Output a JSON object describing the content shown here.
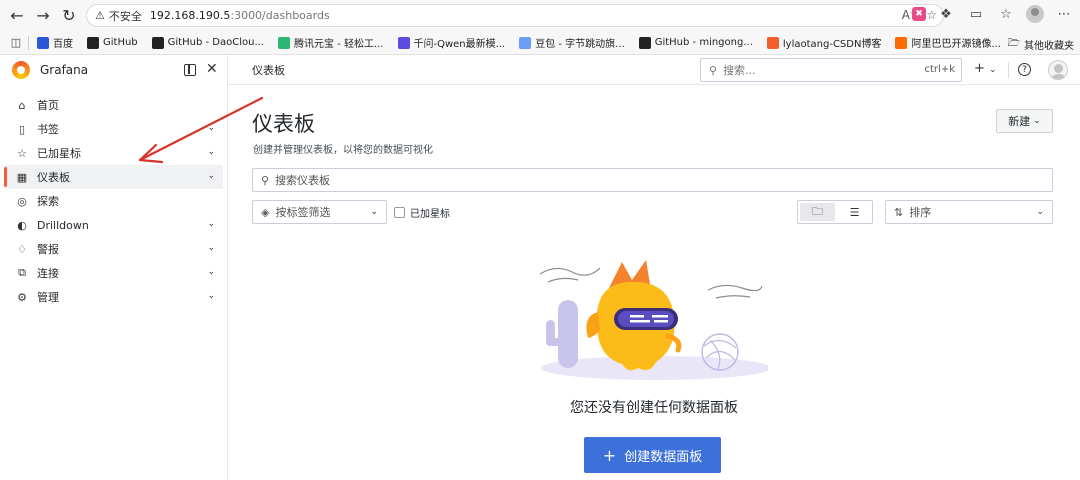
{
  "browser": {
    "security_label": "不安全",
    "url_host": "192.168.190.5",
    "url_path": ":3000/dashboards",
    "bookmarks": [
      {
        "label": "百度",
        "color": "#2b57d6"
      },
      {
        "label": "GitHub",
        "color": "#222222"
      },
      {
        "label": "GitHub - DaoClou...",
        "color": "#222222"
      },
      {
        "label": "腾讯元宝 - 轻松工...",
        "color": "#2bb673"
      },
      {
        "label": "千问-Qwen最新模...",
        "color": "#5b4be0"
      },
      {
        "label": "豆包 - 字节跳动旗...",
        "color": "#6a9ef5"
      },
      {
        "label": "GitHub - mingong...",
        "color": "#222222"
      },
      {
        "label": "lylaotang-CSDN博客",
        "color": "#f25f2c"
      },
      {
        "label": "阿里巴巴开源镜像...",
        "color": "#ff6a00"
      }
    ],
    "other_bookmarks": "其他收藏夹"
  },
  "sidebar": {
    "title": "Grafana",
    "items": [
      {
        "label": "首页",
        "icon": "home-icon",
        "chevron": false,
        "active": false
      },
      {
        "label": "书签",
        "icon": "bookmark-icon",
        "chevron": true,
        "active": false
      },
      {
        "label": "已加星标",
        "icon": "star-icon",
        "chevron": true,
        "active": false
      },
      {
        "label": "仪表板",
        "icon": "apps-icon",
        "chevron": true,
        "active": true
      },
      {
        "label": "探索",
        "icon": "compass-icon",
        "chevron": false,
        "active": false
      },
      {
        "label": "Drilldown",
        "icon": "drilldown-icon",
        "chevron": true,
        "active": false
      },
      {
        "label": "警报",
        "icon": "bell-icon",
        "chevron": true,
        "active": false
      },
      {
        "label": "连接",
        "icon": "link-icon",
        "chevron": true,
        "active": false
      },
      {
        "label": "管理",
        "icon": "cog-icon",
        "chevron": true,
        "active": false
      }
    ]
  },
  "topbar": {
    "breadcrumb": "仪表板",
    "search_placeholder": "搜索...",
    "search_shortcut": "ctrl+k"
  },
  "page": {
    "title": "仪表板",
    "subtitle": "创建并管理仪表板，以将您的数据可视化",
    "new_button": "新建",
    "search_placeholder": "搜索仪表板",
    "tag_filter": "按标签筛选",
    "starred_label": "已加星标",
    "sort_label": "排序",
    "empty_message": "您还没有创建任何数据面板",
    "create_button": "创建数据面板"
  },
  "colors": {
    "accent": "#3d71d9",
    "active_bar": "#f55f3e",
    "annotation_arrow": "#d8322a"
  }
}
